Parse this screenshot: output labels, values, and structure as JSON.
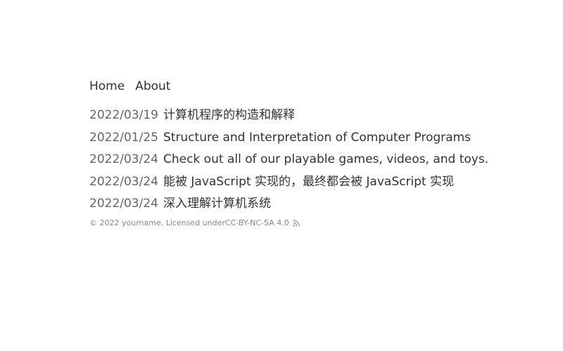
{
  "nav": {
    "items": [
      {
        "label": "Home"
      },
      {
        "label": "About"
      }
    ]
  },
  "posts": [
    {
      "date": "2022/03/19",
      "title": "计算机程序的构造和解释"
    },
    {
      "date": "2022/01/25",
      "title": "Structure and Interpretation of Computer Programs"
    },
    {
      "date": "2022/03/24",
      "title": "Check out all of our playable games, videos, and toys."
    },
    {
      "date": "2022/03/24",
      "title": "能被 JavaScript 实现的，最终都会被 JavaScript 实现"
    },
    {
      "date": "2022/03/24",
      "title": "深入理解计算机系统"
    }
  ],
  "footer": {
    "copyright": "© 2022 yourname. Licensed under ",
    "license": "CC-BY-NC-SA 4.0",
    "rss_icon": "rss-icon",
    "icon_color": "#999999"
  }
}
